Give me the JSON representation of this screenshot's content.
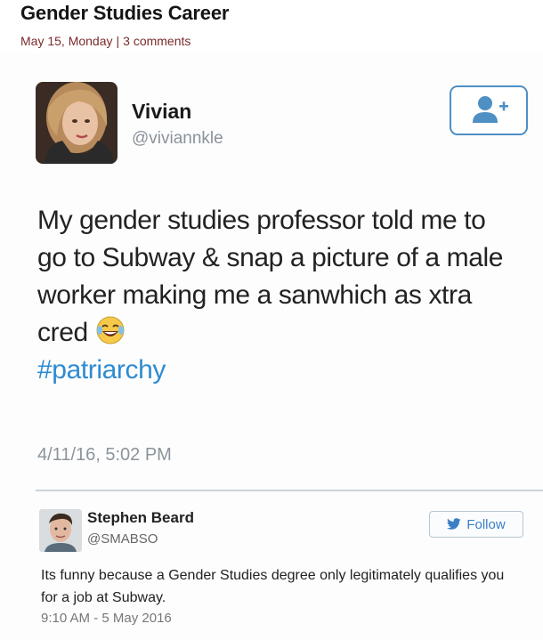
{
  "article": {
    "title": "Gender Studies Career",
    "date": "May 15, Monday",
    "separator": "|",
    "comments": "3 comments"
  },
  "tweet": {
    "author_name": "Vivian",
    "author_handle": "@viviannkle",
    "text": "My gender studies professor told me to go to Subway & snap a picture of a male worker making me a sanwhich as xtra cred",
    "emoji": "face-with-tears-of-joy",
    "hashtag": "#patriarchy",
    "timestamp": "4/11/16, 5:02 PM",
    "follow_icon": "add-user-icon"
  },
  "reply": {
    "author_name": "Stephen Beard",
    "author_handle": "@SMABSO",
    "follow_label": "Follow",
    "follow_icon": "bird-icon",
    "text": "Its funny because a Gender Studies degree only legitimately qualifies you for a job at Subway.",
    "timestamp": "9:10 AM - 5 May 2016"
  },
  "colors": {
    "link": "#2e8bd0",
    "follow_border": "#4e8fc4",
    "meta": "#7a2a2a",
    "muted": "#8c949c"
  }
}
